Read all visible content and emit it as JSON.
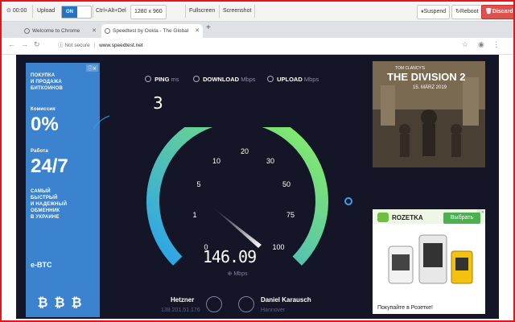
{
  "control_bar": {
    "time": "00:00",
    "upload": "Upload",
    "toggle_on": "ON",
    "ctrl_alt_del": "Ctrl+Alt+Del",
    "resolution": "1280 x 960",
    "fullscreen": "Fullscreen",
    "screenshot": "Screenshot",
    "suspend": "Suspend",
    "reboot": "Reboot",
    "discard": "Discard"
  },
  "browser": {
    "tabs": [
      {
        "label": "Welcome to Chrome",
        "active": false
      },
      {
        "label": "Speedtest by Ookla - The Global",
        "active": true
      }
    ],
    "new_tab": "+",
    "address": {
      "security": "Not secure",
      "separator": "|",
      "url": "www.speedtest.net"
    }
  },
  "speedtest": {
    "ping": {
      "label": "PING",
      "unit": "ms",
      "value": "3"
    },
    "download": {
      "label": "DOWNLOAD",
      "unit": "Mbps"
    },
    "upload": {
      "label": "UPLOAD",
      "unit": "Mbps"
    },
    "gauge": {
      "ticks": [
        "0",
        "1",
        "5",
        "10",
        "20",
        "30",
        "50",
        "75",
        "100"
      ],
      "current_speed": "146.09",
      "unit": "Mbps"
    },
    "isp": {
      "name": "Hetzner",
      "ip": "138.201.51.176"
    },
    "server": {
      "name": "Daniel Karausch",
      "location": "Hannover"
    },
    "colors": {
      "arc_start": "#2aa1ee",
      "arc_end": "#8df25c",
      "background": "#141526"
    }
  },
  "ads": {
    "left": {
      "ad_badge": "ⓘ✕",
      "lines_1": [
        "ПОКУПКА",
        "И ПРОДАЖА",
        "БИТКОИНОВ"
      ],
      "label_1": "Комиссия",
      "big_1": "0%",
      "label_2": "Работа",
      "big_2": "24/7",
      "lines_2": [
        "САМЫЙ",
        "БЫСТРЫЙ",
        "И НАДЕЖНЫЙ",
        "ОБМЕННИК",
        "В УКРАИНЕ"
      ],
      "brand": "e-BTC",
      "btc_symbols": "₿₿₿"
    },
    "game": {
      "publisher": "TOM CLANCY'S",
      "title": "THE DIVISION 2",
      "date": "15. MÄRZ 2019"
    },
    "rozetka": {
      "brand": "ROZETKA",
      "button": "Выбрать",
      "caption": "Покупайте в Розетке!",
      "ad_badge": "ⓘ✕"
    }
  }
}
